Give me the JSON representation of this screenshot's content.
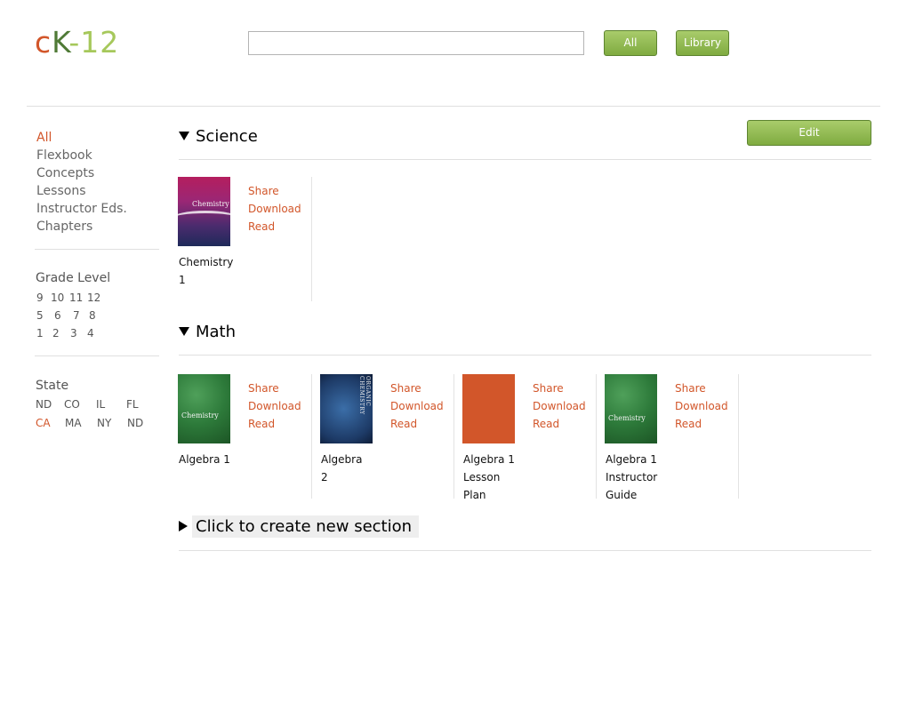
{
  "logo": {
    "c": "c",
    "k": "K",
    "rest": "-12"
  },
  "header": {
    "search_placeholder": "",
    "all_button": "All",
    "library_button": "Library"
  },
  "sidebar": {
    "filters": [
      "All",
      "Flexbook",
      "Concepts",
      "Lessons",
      "Instructor Eds.",
      "Chapters"
    ],
    "grade_heading": "Grade Level",
    "grades": [
      [
        "9",
        "10",
        "11",
        "12"
      ],
      [
        "5",
        "6",
        "7",
        "8"
      ],
      [
        "1",
        "2",
        "3",
        "4"
      ]
    ],
    "state_heading": "State",
    "states": [
      [
        "ND",
        "CO",
        "IL",
        "FL"
      ],
      [
        "CA",
        "MA",
        "NY",
        "ND"
      ]
    ]
  },
  "edit_button": "Edit",
  "actions": {
    "share": "Share",
    "download": "Download",
    "read": "Read"
  },
  "sections": [
    {
      "title": "Science",
      "items": [
        {
          "title": "Chemistry 1",
          "cover": "Chemistry"
        }
      ]
    },
    {
      "title": "Math",
      "items": [
        {
          "title": "Algebra 1",
          "cover": "Chemistry"
        },
        {
          "title": "Algebra 2",
          "cover": "ORGANIC CHEMISTRY"
        },
        {
          "title": "Algebra 1 Lesson Plan",
          "cover": ""
        },
        {
          "title": "Algebra 1 Instructor Guide",
          "cover": "Chemistry"
        }
      ]
    }
  ],
  "new_section_label": "Click to create new section",
  "colors": {
    "accent": "#d2562a",
    "button_green": "#8bb54e",
    "logo_k": "#4f7a36",
    "logo_rest": "#a6c85b"
  }
}
